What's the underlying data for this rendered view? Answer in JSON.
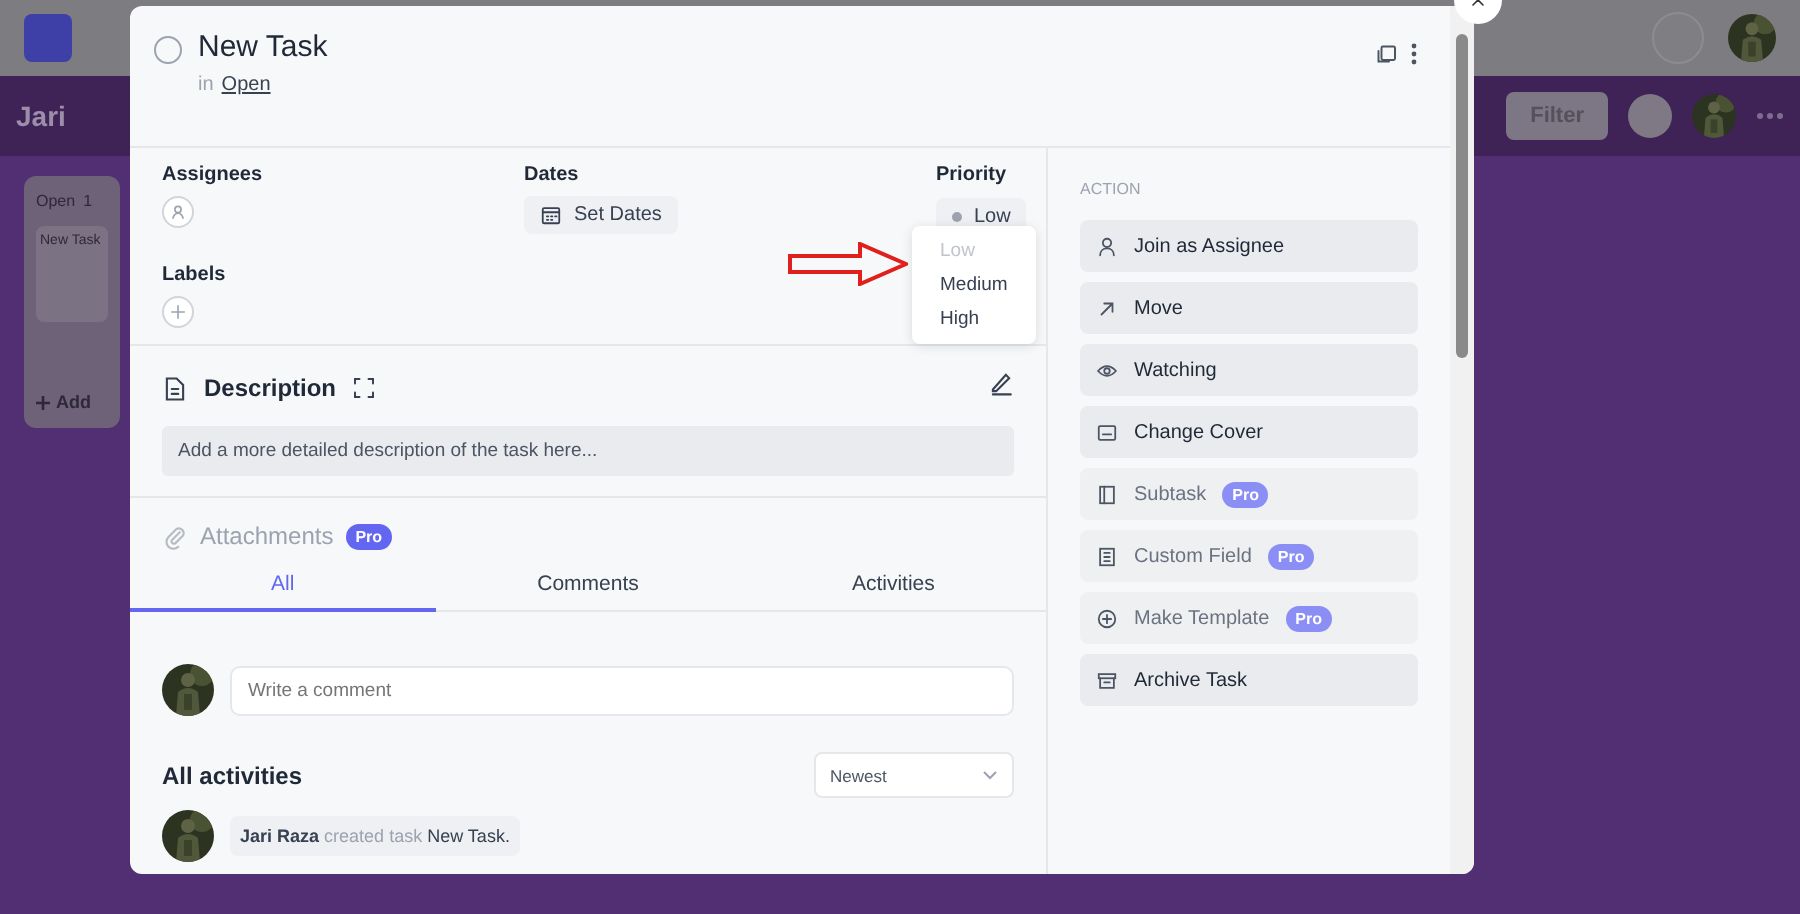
{
  "board": {
    "title": "Jari",
    "filter": "Filter",
    "column": {
      "title": "Open",
      "count": "1",
      "cards": [
        {
          "title": "New Task"
        }
      ],
      "add": "Add"
    }
  },
  "task": {
    "title": "New Task",
    "completed": false,
    "list_prefix": "in",
    "list": "Open"
  },
  "fields": {
    "assignees": "Assignees",
    "dates": "Dates",
    "set_dates": "Set Dates",
    "priority": "Priority",
    "priority_value": "Low",
    "labels": "Labels"
  },
  "priority_menu": [
    {
      "label": "Low",
      "selected": true
    },
    {
      "label": "Medium",
      "selected": false
    },
    {
      "label": "High",
      "selected": false
    }
  ],
  "description": {
    "title": "Description",
    "placeholder": "Add a more detailed description of the task here..."
  },
  "attachments": {
    "title": "Attachments",
    "badge": "Pro"
  },
  "tabs": [
    {
      "label": "All",
      "selected": true
    },
    {
      "label": "Comments",
      "selected": false
    },
    {
      "label": "Activities",
      "selected": false
    }
  ],
  "comment": {
    "placeholder": "Write a comment"
  },
  "activities": {
    "title": "All activities",
    "sort": "Newest",
    "entries": [
      {
        "user": "Jari Raza",
        "action": "created task",
        "target": "New Task."
      }
    ]
  },
  "sidebar": {
    "heading": "ACTION",
    "actions": [
      {
        "label": "Join as Assignee",
        "disabled": false
      },
      {
        "label": "Move",
        "disabled": false
      },
      {
        "label": "Watching",
        "disabled": false
      },
      {
        "label": "Change Cover",
        "disabled": false
      },
      {
        "label": "Subtask",
        "disabled": true,
        "badge": "Pro"
      },
      {
        "label": "Custom Field",
        "disabled": true,
        "badge": "Pro"
      },
      {
        "label": "Make Template",
        "disabled": true,
        "badge": "Pro"
      },
      {
        "label": "Archive Task",
        "disabled": false
      }
    ]
  }
}
